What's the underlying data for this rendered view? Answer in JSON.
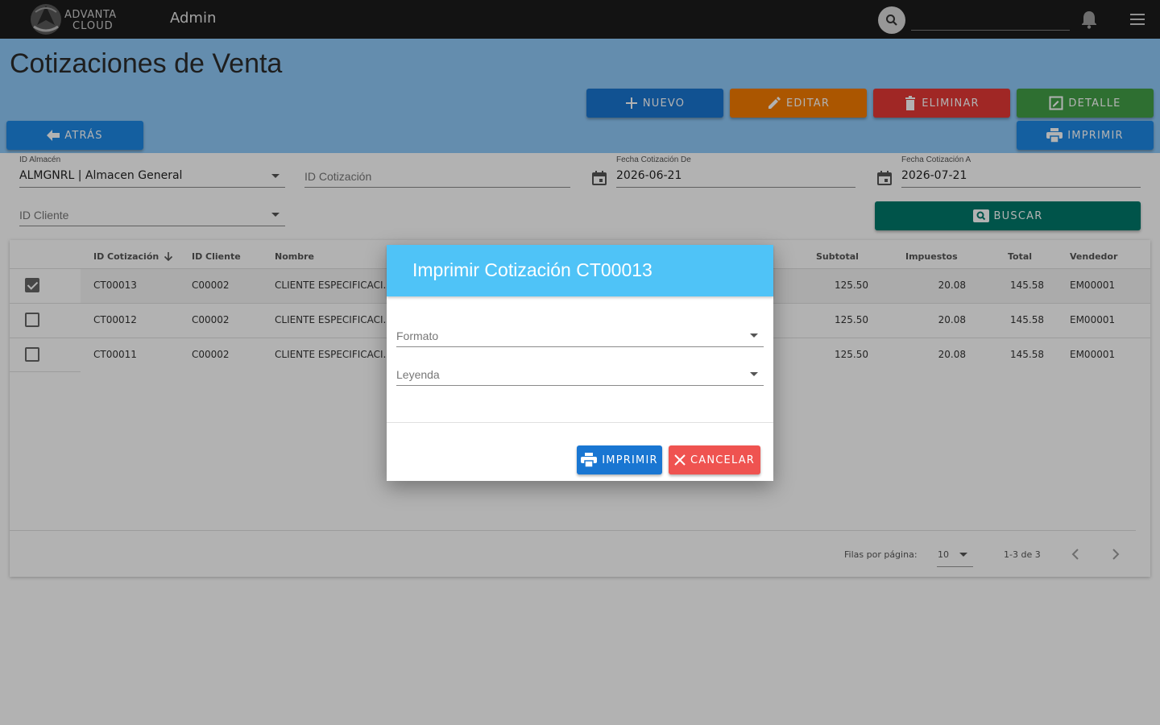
{
  "topbar": {
    "logo_line1": "ADVANTA",
    "logo_line2": "CLOUD",
    "app_title": "Admin",
    "search_placeholder": ""
  },
  "page": {
    "title": "Cotizaciones de Venta"
  },
  "actions": {
    "nuevo": "NUEVO",
    "editar": "EDITAR",
    "eliminar": "ELIMINAR",
    "detalle": "DETALLE",
    "atras": "ATRÁS",
    "imprimir": "IMPRIMIR"
  },
  "filters": {
    "almacen_label": "ID Almacén",
    "almacen_value": "ALMGNRL | Almacen General",
    "cotizacion_placeholder": "ID Cotización",
    "fecha_de_label": "Fecha Cotización De",
    "fecha_de_value": "2026-06-21",
    "fecha_a_label": "Fecha Cotización A",
    "fecha_a_value": "2026-07-21",
    "cliente_placeholder": "ID Cliente",
    "buscar": "BUSCAR"
  },
  "table": {
    "headers": {
      "id_cotizacion": "ID Cotización",
      "id_cliente": "ID Cliente",
      "nombre": "Nombre",
      "subtotal": "Subtotal",
      "impuestos": "Impuestos",
      "total": "Total",
      "vendedor": "Vendedor"
    },
    "rows": [
      {
        "checked": true,
        "id": "CT00013",
        "cliente": "C00002",
        "nombre": "CLIENTE ESPECIFICACI...",
        "subtotal": "125.50",
        "impuestos": "20.08",
        "total": "145.58",
        "vendedor": "EM00001"
      },
      {
        "checked": false,
        "id": "CT00012",
        "cliente": "C00002",
        "nombre": "CLIENTE ESPECIFICACI...",
        "subtotal": "125.50",
        "impuestos": "20.08",
        "total": "145.58",
        "vendedor": "EM00001"
      },
      {
        "checked": false,
        "id": "CT00011",
        "cliente": "C00002",
        "nombre": "CLIENTE ESPECIFICACI...",
        "subtotal": "125.50",
        "impuestos": "20.08",
        "total": "145.58",
        "vendedor": "EM00001"
      }
    ],
    "pager": {
      "rows_per_page_label": "Filas por página:",
      "rows_per_page_value": "10",
      "range": "1-3 de 3"
    }
  },
  "dialog": {
    "title": "Imprimir Cotización CT00013",
    "formato_placeholder": "Formato",
    "leyenda_placeholder": "Leyenda",
    "imprimir": "IMPRIMIR",
    "cancelar": "CANCELAR"
  },
  "colors": {
    "topbar": "#1c1c1c",
    "band": "#90caf9",
    "nuevo": "#1976d2",
    "editar": "#f57c00",
    "eliminar": "#e53935",
    "detalle": "#43a047",
    "atras": "#1e88e5",
    "imprimir": "#1e88e5",
    "buscar": "#00796b",
    "dialog_header": "#4fc3f7",
    "cancelar": "#ef5350"
  }
}
